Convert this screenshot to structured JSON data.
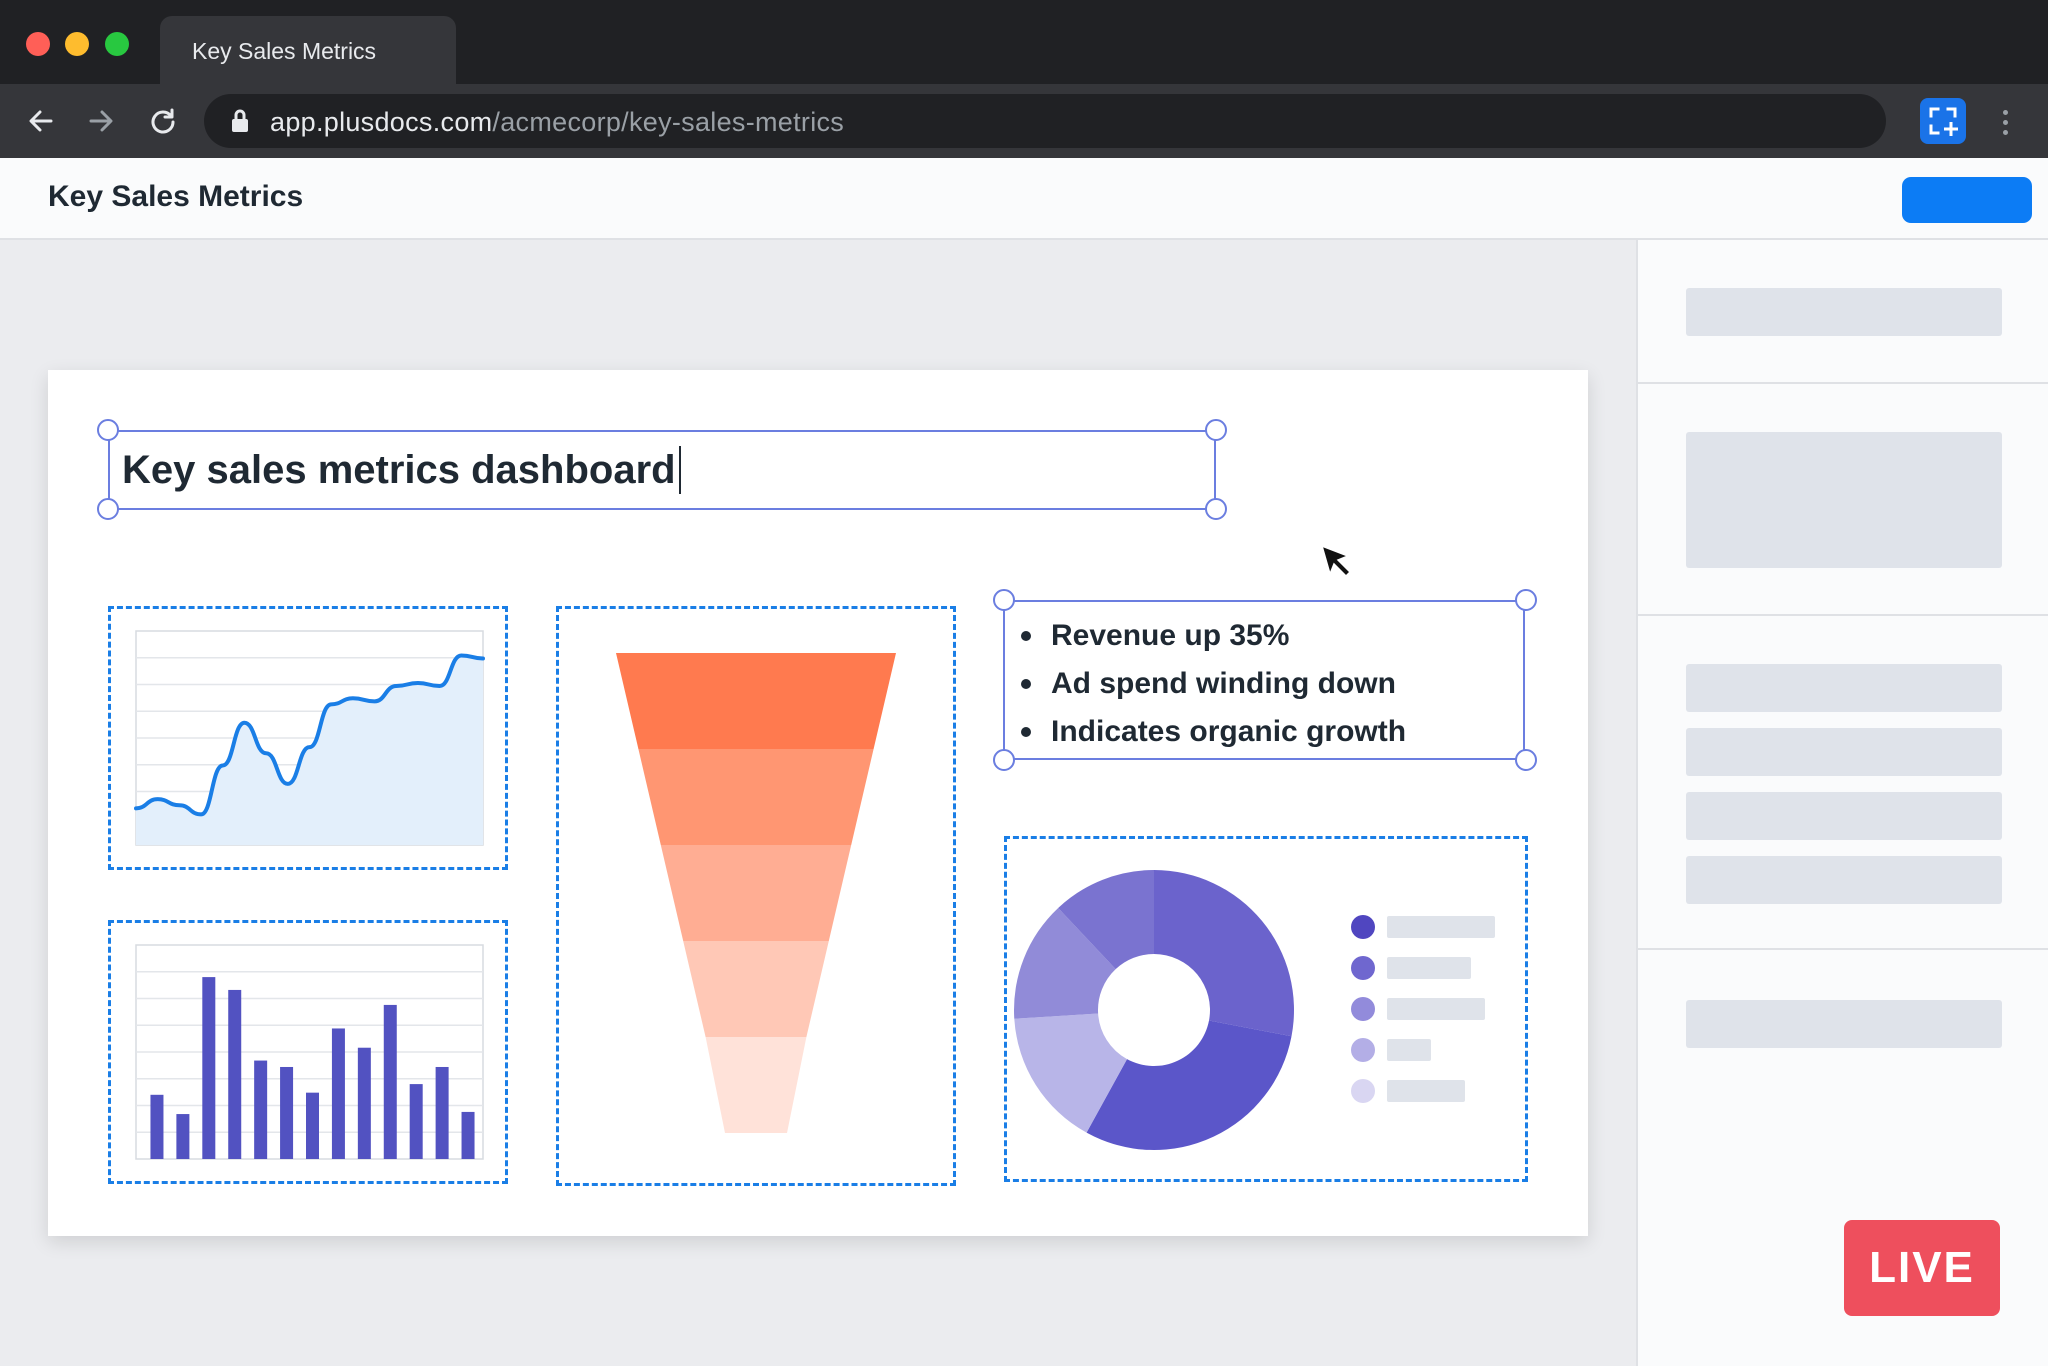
{
  "browser": {
    "tab_title": "Key Sales Metrics",
    "url_host": "app.plusdocs.com",
    "url_path": "/acmecorp/key-sales-metrics"
  },
  "app": {
    "title": "Key Sales Metrics"
  },
  "slide": {
    "title": "Key sales metrics dashboard",
    "bullets": [
      "Revenue up 35%",
      "Ad spend winding down",
      "Indicates organic growth"
    ]
  },
  "status": {
    "live_label": "LIVE"
  },
  "colors": {
    "accent": "#0c7cf5",
    "selection": "#6b7ee0",
    "line_series": "#1a7ee6",
    "bar_series": "#5252c1",
    "live": "#ee4f5d"
  },
  "chart_data": [
    {
      "type": "area",
      "y": [
        1.2,
        1.5,
        1.3,
        1.0,
        2.6,
        4.0,
        3.0,
        2.0,
        3.2,
        4.6,
        4.8,
        4.7,
        5.2,
        5.3,
        5.2,
        6.2,
        6.1
      ],
      "grid": true
    },
    {
      "type": "bar",
      "values": [
        3.0,
        2.1,
        8.5,
        7.9,
        4.6,
        4.3,
        3.1,
        6.1,
        5.2,
        7.2,
        3.5,
        4.3,
        2.2
      ],
      "grid": true
    },
    {
      "type": "bar",
      "subtype": "funnel",
      "values": [
        100,
        84,
        68,
        52,
        36
      ]
    },
    {
      "type": "pie",
      "subtype": "donut",
      "values": [
        28,
        30,
        16,
        14,
        12
      ]
    }
  ]
}
